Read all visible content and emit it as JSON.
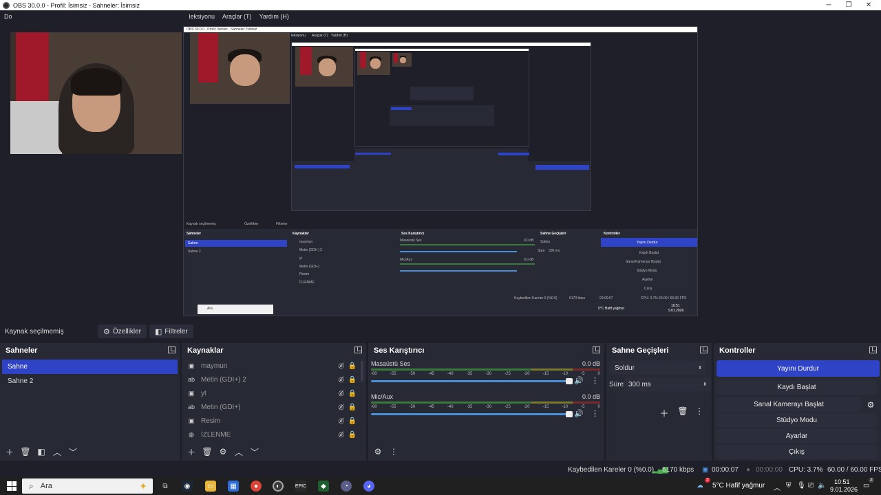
{
  "window": {
    "title": "OBS 30.0.0 - Profil: İsimsiz - Sahneler: İsimsiz",
    "min": "─",
    "max": "❐",
    "close": "✕"
  },
  "menu": {
    "items": [
      "Do",
      "leksiyonu",
      "Araçlar (T)",
      "Yardım (H)"
    ]
  },
  "nested": {
    "title": "OBS 30.0.0 - Profil: İsimsiz - Sahneler: İsimsiz",
    "menu_a": "leksiyonu",
    "menu_b": "Araçlar (T)",
    "menu_c": "Yardım (H)",
    "source_none": "Kaynak seçilmemiş",
    "props": "Özellikler",
    "filters": "Filtreler",
    "scenes": "Sahneler",
    "sources": "Kaynaklar",
    "mixer": "Ses Karıştırıcı",
    "trans": "Sahne Geçişleri",
    "controls": "Kontroller",
    "scene1": "Sahne",
    "scene2": "Sahne 2",
    "src": [
      "maymun",
      "Metin (GDI+) 2",
      "yt",
      "Metin (GDI+)",
      "Resim",
      "İZLENME"
    ],
    "ch1": "Masaüstü Ses",
    "ch2": "Mic/Aux",
    "db": "0.0 dB",
    "trans_sel": "Soldur",
    "dur_label": "Süre",
    "dur_val": "300 ms",
    "ctrl": [
      "Yayını Durdur",
      "Kaydı Başlat",
      "Sanal Kamerayı Başlat",
      "Stüdyo Modu",
      "Ayarlar",
      "Çıkış"
    ],
    "search": "Ara",
    "status_dropped": "Kaybedilen Kareler 0 (%0.0)",
    "status_kbps": "6170 kbps",
    "status_time": "00:00:07",
    "status_rec": "00:00:00",
    "status_cpu": "CPU: 3.7%",
    "status_fps": "60.00 / 60.00 FPS",
    "weather": "5°C Hafif yağmur",
    "time": "10:51",
    "date": "9.01.2026"
  },
  "midbar": {
    "source_none": "Kaynak seçilmemiş",
    "props_label": "Özellikler",
    "filters_label": "Filtreler"
  },
  "scenes": {
    "title": "Sahneler",
    "items": [
      "Sahne",
      "Sahne 2"
    ]
  },
  "sources": {
    "title": "Kaynaklar",
    "items": [
      {
        "label": "maymun",
        "icon": "image-icon"
      },
      {
        "label": "Metin (GDI+) 2",
        "icon": "text-icon"
      },
      {
        "label": "yt",
        "icon": "image-icon"
      },
      {
        "label": "Metin (GDI+)",
        "icon": "text-icon"
      },
      {
        "label": "Resim",
        "icon": "image-icon"
      },
      {
        "label": "İZLENME",
        "icon": "browser-icon"
      }
    ]
  },
  "mixer": {
    "title": "Ses Karıştırıcı",
    "channels": [
      {
        "name": "Masaüstü Ses",
        "db": "0.0 dB"
      },
      {
        "name": "Mic/Aux",
        "db": "0.0 dB"
      }
    ],
    "ticks": [
      "-60",
      "-55",
      "-50",
      "-45",
      "-40",
      "-35",
      "-30",
      "-25",
      "-20",
      "-15",
      "-10",
      "-5",
      "0"
    ]
  },
  "transitions": {
    "title": "Sahne Geçişleri",
    "selected": "Soldur",
    "duration_label": "Süre",
    "duration_value": "300 ms"
  },
  "controls": {
    "title": "Kontroller",
    "stop_stream": "Yayını Durdur",
    "start_record": "Kaydı Başlat",
    "start_virtualcam": "Sanal Kamerayı Başlat",
    "studio_mode": "Stüdyo Modu",
    "settings": "Ayarlar",
    "exit": "Çıkış"
  },
  "status": {
    "dropped": "Kaybedilen Kareler 0 (%0.0)",
    "bitrate": "6170 kbps",
    "stream_time": "00:00:07",
    "record_time": "00:00:00",
    "cpu": "CPU: 3.7%",
    "fps": "60.00 / 60.00 FPS"
  },
  "taskbar": {
    "search_placeholder": "Ara",
    "weather_badge": "2",
    "weather": "5°C  Hafif yağmur",
    "time": "10:51",
    "date": "9.01.2026",
    "notif_badge": "2"
  },
  "colors": {
    "accent": "#2f43c7",
    "bg": "#1e1f29",
    "panel": "#272935"
  }
}
